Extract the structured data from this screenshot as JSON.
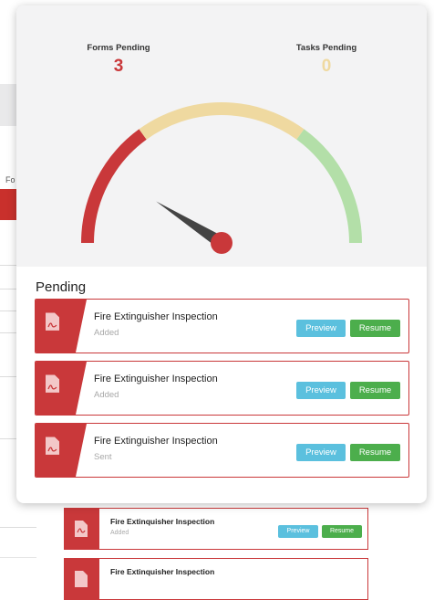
{
  "background": {
    "column_label": "Fo",
    "cards": [
      {
        "title": "Fire Extinquisher Inspection",
        "status": "Added",
        "preview_label": "Preview",
        "resume_label": "Resume"
      },
      {
        "title": "Fire Extinquisher Inspection",
        "status": "",
        "preview_label": "",
        "resume_label": ""
      }
    ]
  },
  "summary": {
    "forms_pending_label": "Forms Pending",
    "forms_pending_value": "3",
    "tasks_pending_label": "Tasks Pending",
    "tasks_pending_value": "0"
  },
  "gauge": {
    "segment_colors": [
      "#c9383a",
      "#efd9a0",
      "#b3dfa8"
    ],
    "needle_color": "#444444",
    "hub_color": "#c9383a",
    "level": 0.18
  },
  "pending": {
    "title": "Pending",
    "items": [
      {
        "title": "Fire Extinguisher Inspection",
        "status": "Added",
        "preview_label": "Preview",
        "resume_label": "Resume",
        "icon": "pdf-file-icon"
      },
      {
        "title": "Fire Extinguisher Inspection",
        "status": "Added",
        "preview_label": "Preview",
        "resume_label": "Resume",
        "icon": "pdf-file-icon"
      },
      {
        "title": "Fire Extinguisher Inspection",
        "status": "Sent",
        "preview_label": "Preview",
        "resume_label": "Resume",
        "icon": "pdf-file-icon"
      }
    ]
  },
  "colors": {
    "forms_value": "#c9383a",
    "tasks_value": "#efd9a0",
    "accent": "#c9383a",
    "preview_button": "#5bc0de",
    "resume_button": "#4cae4c"
  }
}
